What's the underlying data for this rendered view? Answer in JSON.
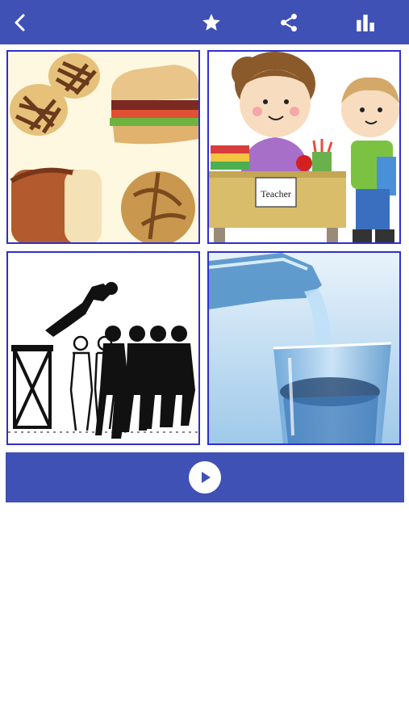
{
  "colors": {
    "primary": "#3f51b5",
    "cell_border": "#2f2fd0",
    "background": "#ffffff"
  },
  "toolbar": {
    "back_icon": "chevron-left-icon",
    "favorite_icon": "star-icon",
    "share_icon": "share-icon",
    "stats_icon": "bar-chart-icon"
  },
  "grid": {
    "cells": [
      {
        "name": "bread-foods-picture"
      },
      {
        "name": "teacher-student-picture",
        "label": "Teacher"
      },
      {
        "name": "crowd-silhouette-picture"
      },
      {
        "name": "water-glass-picture"
      }
    ]
  },
  "player": {
    "icon": "play-icon"
  }
}
